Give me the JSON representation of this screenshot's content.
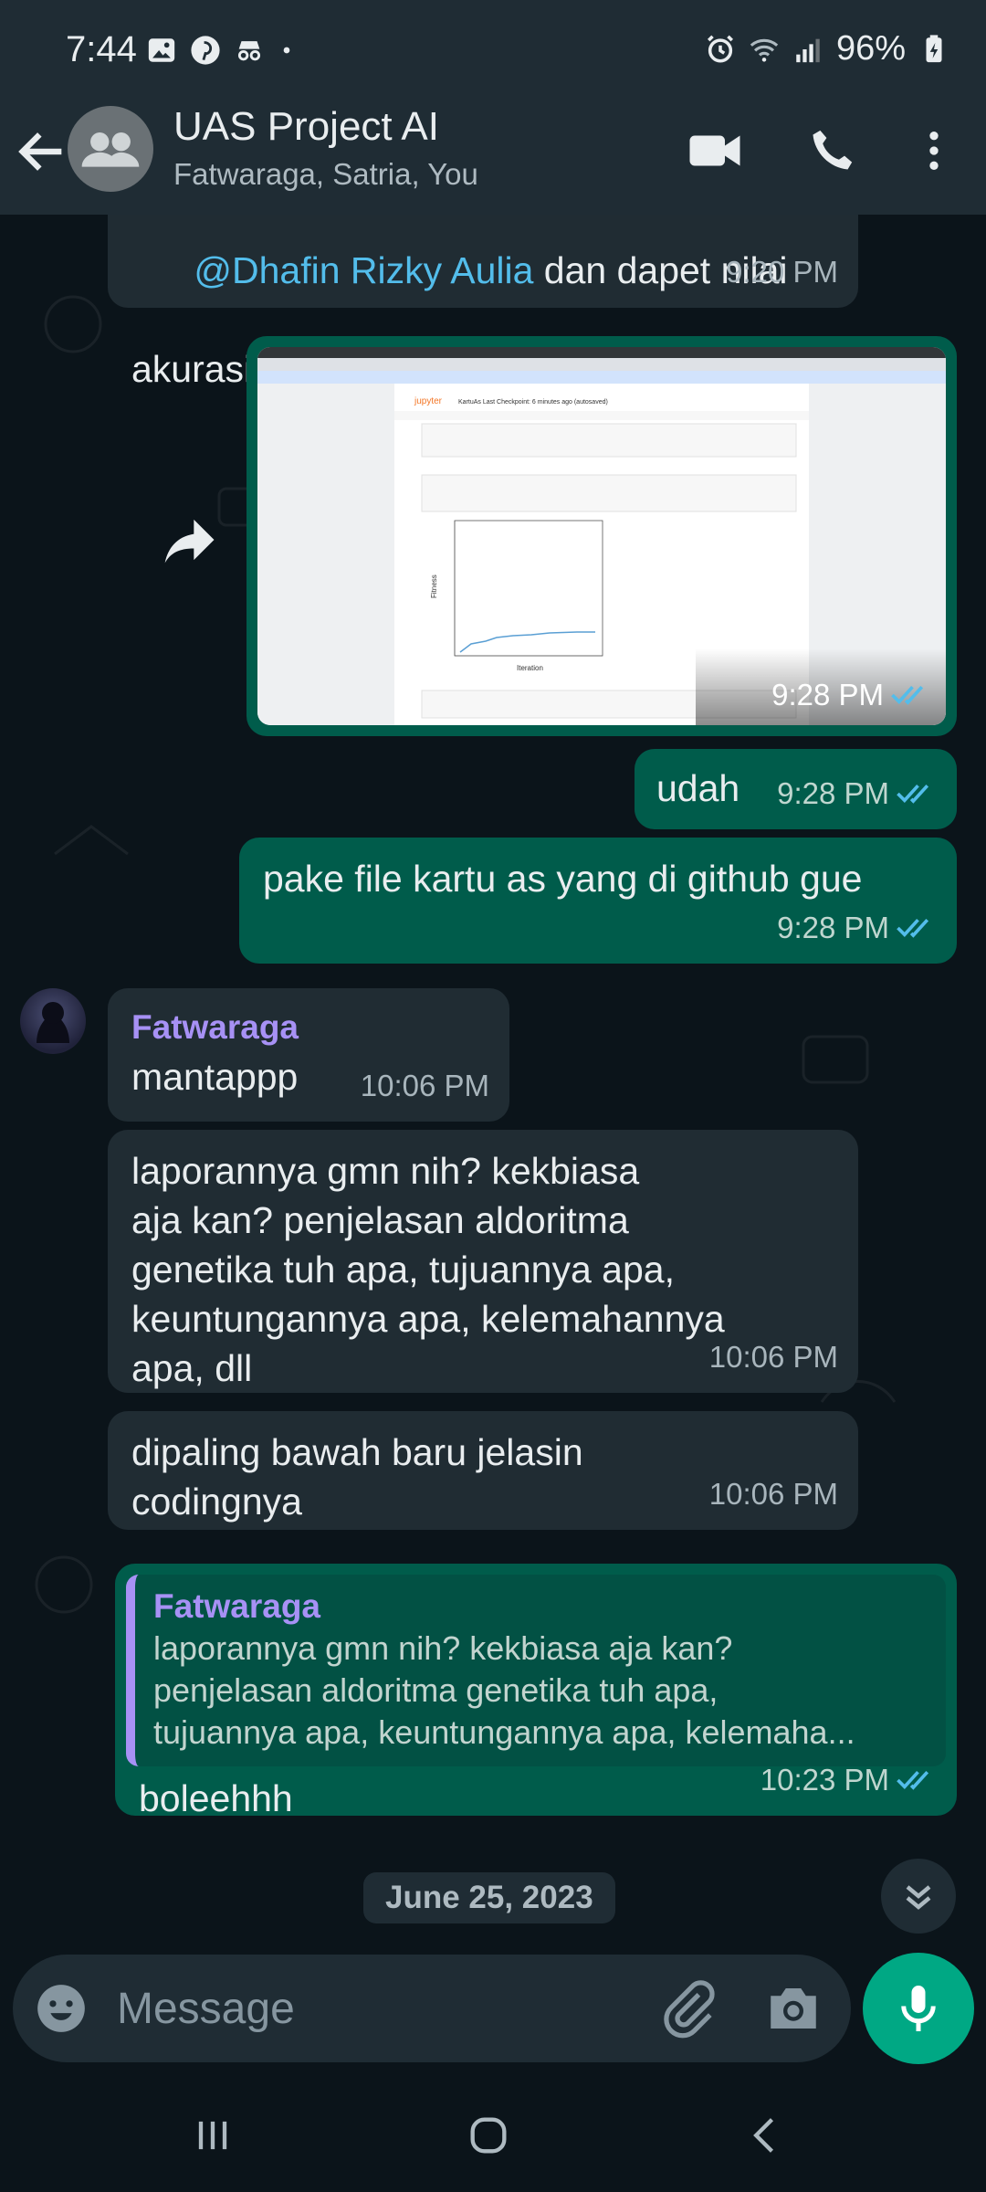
{
  "status_bar": {
    "time": "7:44",
    "battery": "96%",
    "left_icons": [
      "gallery-icon",
      "pinterest-icon",
      "incognito-icon",
      "dot-icon"
    ],
    "right_icons": [
      "alarm-icon",
      "wifi-icon",
      "signal-icon",
      "battery-charging-icon"
    ]
  },
  "header": {
    "title": "UAS Project AI",
    "subtitle": "Fatwaraga, Satria, You",
    "icons": [
      "back-arrow-icon",
      "group-avatar-icon",
      "video-call-icon",
      "phone-icon",
      "more-vert-icon"
    ]
  },
  "messages": [
    {
      "id": "m1",
      "direction": "in",
      "mention": "@Dhafin Rizky Aulia",
      "text_after_mention": " dan dapet nilai",
      "text_line2": "akurasi?",
      "time": "9:20 PM"
    },
    {
      "id": "m2",
      "direction": "out",
      "type": "image",
      "image_description_icon": "screenshot-image",
      "time": "9:28 PM",
      "read": true
    },
    {
      "id": "m3",
      "direction": "out",
      "text": "udah",
      "time": "9:28 PM",
      "read": true
    },
    {
      "id": "m4",
      "direction": "out",
      "text": "pake file kartu as yang di github gue",
      "time": "9:28 PM",
      "read": true
    },
    {
      "id": "m5",
      "direction": "in",
      "sender": "Fatwaraga",
      "text": "mantappp",
      "time": "10:06 PM"
    },
    {
      "id": "m6",
      "direction": "in",
      "text": "laporannya gmn nih? kekbiasa\naja kan? penjelasan aldoritma\ngenetika tuh apa, tujuannya apa,\nkeuntungannya apa, kelemahannya\napa, dll",
      "time": "10:06 PM"
    },
    {
      "id": "m7",
      "direction": "in",
      "text": "dipaling bawah baru jelasin\ncodingnya",
      "time": "10:06 PM"
    },
    {
      "id": "m8",
      "direction": "out",
      "quote_sender": "Fatwaraga",
      "quote_text": "laporannya gmn nih? kekbiasa aja kan?\npenjelasan aldoritma genetika tuh apa,\ntujuannya apa, keuntungannya apa, kelemaha...",
      "text": "boleehhh",
      "time": "10:23 PM",
      "read": true
    }
  ],
  "date_chip": "June 25, 2023",
  "screenshot_thumb": {
    "app_name": "jupyter",
    "notebook_title": "KartuAs Last Checkpoint: 6 minutes ago (autosaved)",
    "chart_ylabel": "Fitness",
    "chart_xlabel": "Iteration"
  },
  "input": {
    "placeholder": "Message"
  },
  "colors": {
    "background": "#0b141a",
    "header": "#1f2c34",
    "incoming": "#202c33",
    "outgoing": "#005c4b",
    "accent": "#00a884",
    "mention": "#53bdeb",
    "sender": "#a791f5",
    "read_ticks": "#53bdeb"
  }
}
